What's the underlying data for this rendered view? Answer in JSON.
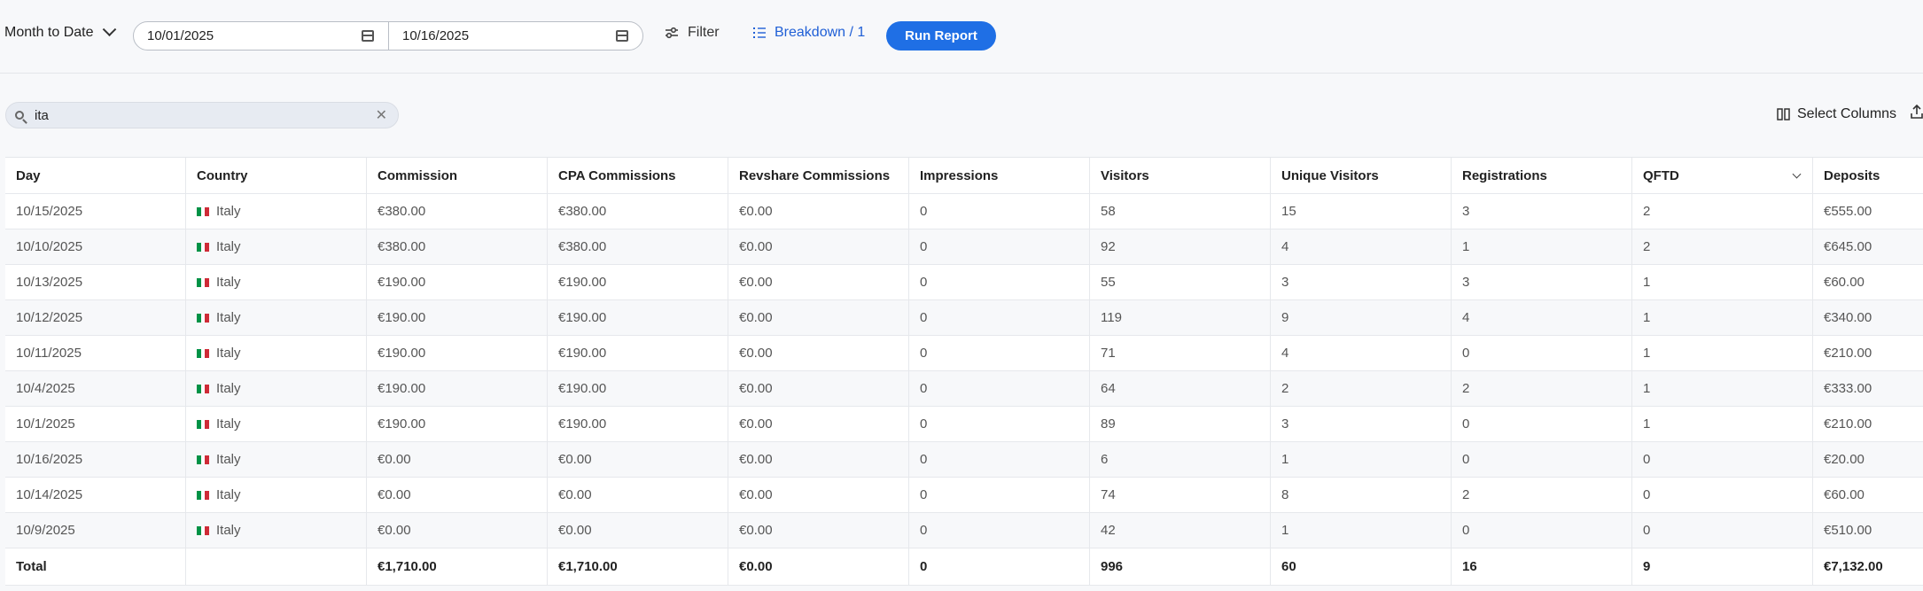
{
  "toolbar": {
    "period_label": "Month to Date",
    "date_from": "10/01/2025",
    "date_to": "10/16/2025",
    "filter_label": "Filter",
    "breakdown_label": "Breakdown / 1",
    "run_report_label": "Run Report",
    "colors": {
      "accent": "#1f6fe5",
      "link": "#1f5fd6"
    }
  },
  "search": {
    "value": "ita"
  },
  "actions": {
    "select_columns_label": "Select Columns"
  },
  "table": {
    "columns": [
      "Day",
      "Country",
      "Commission",
      "CPA Commissions",
      "Revshare Commissions",
      "Impressions",
      "Visitors",
      "Unique Visitors",
      "Registrations",
      "QFTD",
      "Deposits"
    ],
    "rows": [
      [
        "10/15/2025",
        "Italy",
        "€380.00",
        "€380.00",
        "€0.00",
        "0",
        "58",
        "15",
        "3",
        "2",
        "€555.00"
      ],
      [
        "10/10/2025",
        "Italy",
        "€380.00",
        "€380.00",
        "€0.00",
        "0",
        "92",
        "4",
        "1",
        "2",
        "€645.00"
      ],
      [
        "10/13/2025",
        "Italy",
        "€190.00",
        "€190.00",
        "€0.00",
        "0",
        "55",
        "3",
        "3",
        "1",
        "€60.00"
      ],
      [
        "10/12/2025",
        "Italy",
        "€190.00",
        "€190.00",
        "€0.00",
        "0",
        "119",
        "9",
        "4",
        "1",
        "€340.00"
      ],
      [
        "10/11/2025",
        "Italy",
        "€190.00",
        "€190.00",
        "€0.00",
        "0",
        "71",
        "4",
        "0",
        "1",
        "€210.00"
      ],
      [
        "10/4/2025",
        "Italy",
        "€190.00",
        "€190.00",
        "€0.00",
        "0",
        "64",
        "2",
        "2",
        "1",
        "€333.00"
      ],
      [
        "10/1/2025",
        "Italy",
        "€190.00",
        "€190.00",
        "€0.00",
        "0",
        "89",
        "3",
        "0",
        "1",
        "€210.00"
      ],
      [
        "10/16/2025",
        "Italy",
        "€0.00",
        "€0.00",
        "€0.00",
        "0",
        "6",
        "1",
        "0",
        "0",
        "€20.00"
      ],
      [
        "10/14/2025",
        "Italy",
        "€0.00",
        "€0.00",
        "€0.00",
        "0",
        "74",
        "8",
        "2",
        "0",
        "€60.00"
      ],
      [
        "10/9/2025",
        "Italy",
        "€0.00",
        "€0.00",
        "€0.00",
        "0",
        "42",
        "1",
        "0",
        "0",
        "€510.00"
      ]
    ],
    "total": [
      "Total",
      "",
      "€1,710.00",
      "€1,710.00",
      "€0.00",
      "0",
      "996",
      "60",
      "16",
      "9",
      "€7,132.00"
    ]
  }
}
